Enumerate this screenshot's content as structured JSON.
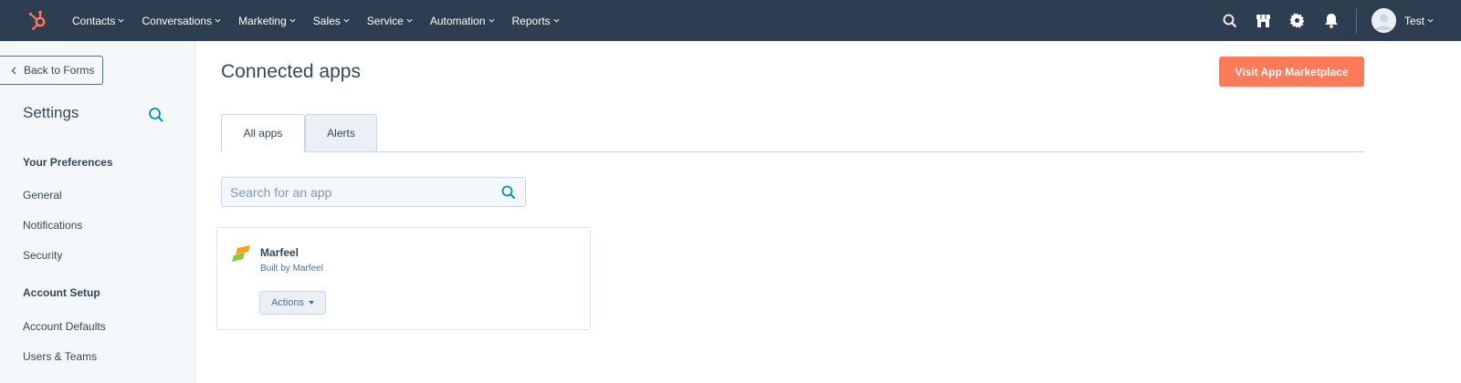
{
  "topnav": {
    "items": [
      {
        "label": "Contacts"
      },
      {
        "label": "Conversations"
      },
      {
        "label": "Marketing"
      },
      {
        "label": "Sales"
      },
      {
        "label": "Service"
      },
      {
        "label": "Automation"
      },
      {
        "label": "Reports"
      }
    ],
    "user_name": "Test",
    "icons": [
      "search-icon",
      "marketplace-icon",
      "gear-icon",
      "bell-icon"
    ]
  },
  "sidebar": {
    "back_label": "Back to Forms",
    "title": "Settings",
    "sections": [
      {
        "heading": "Your Preferences",
        "links": [
          "General",
          "Notifications",
          "Security"
        ]
      },
      {
        "heading": "Account Setup",
        "links": [
          "Account Defaults",
          "Users & Teams"
        ]
      }
    ]
  },
  "main": {
    "title": "Connected apps",
    "marketplace_button": "Visit App Marketplace",
    "tabs": [
      {
        "label": "All apps",
        "active": true
      },
      {
        "label": "Alerts",
        "active": false
      }
    ],
    "search": {
      "placeholder": "Search for an app",
      "value": ""
    },
    "apps": [
      {
        "name": "Marfeel",
        "subtitle": "Built by Marfeel",
        "actions_label": "Actions"
      }
    ]
  },
  "colors": {
    "nav_bg": "#2d3e50",
    "accent": "#ff7a59",
    "link_teal": "#0091ae",
    "text": "#33475b"
  }
}
